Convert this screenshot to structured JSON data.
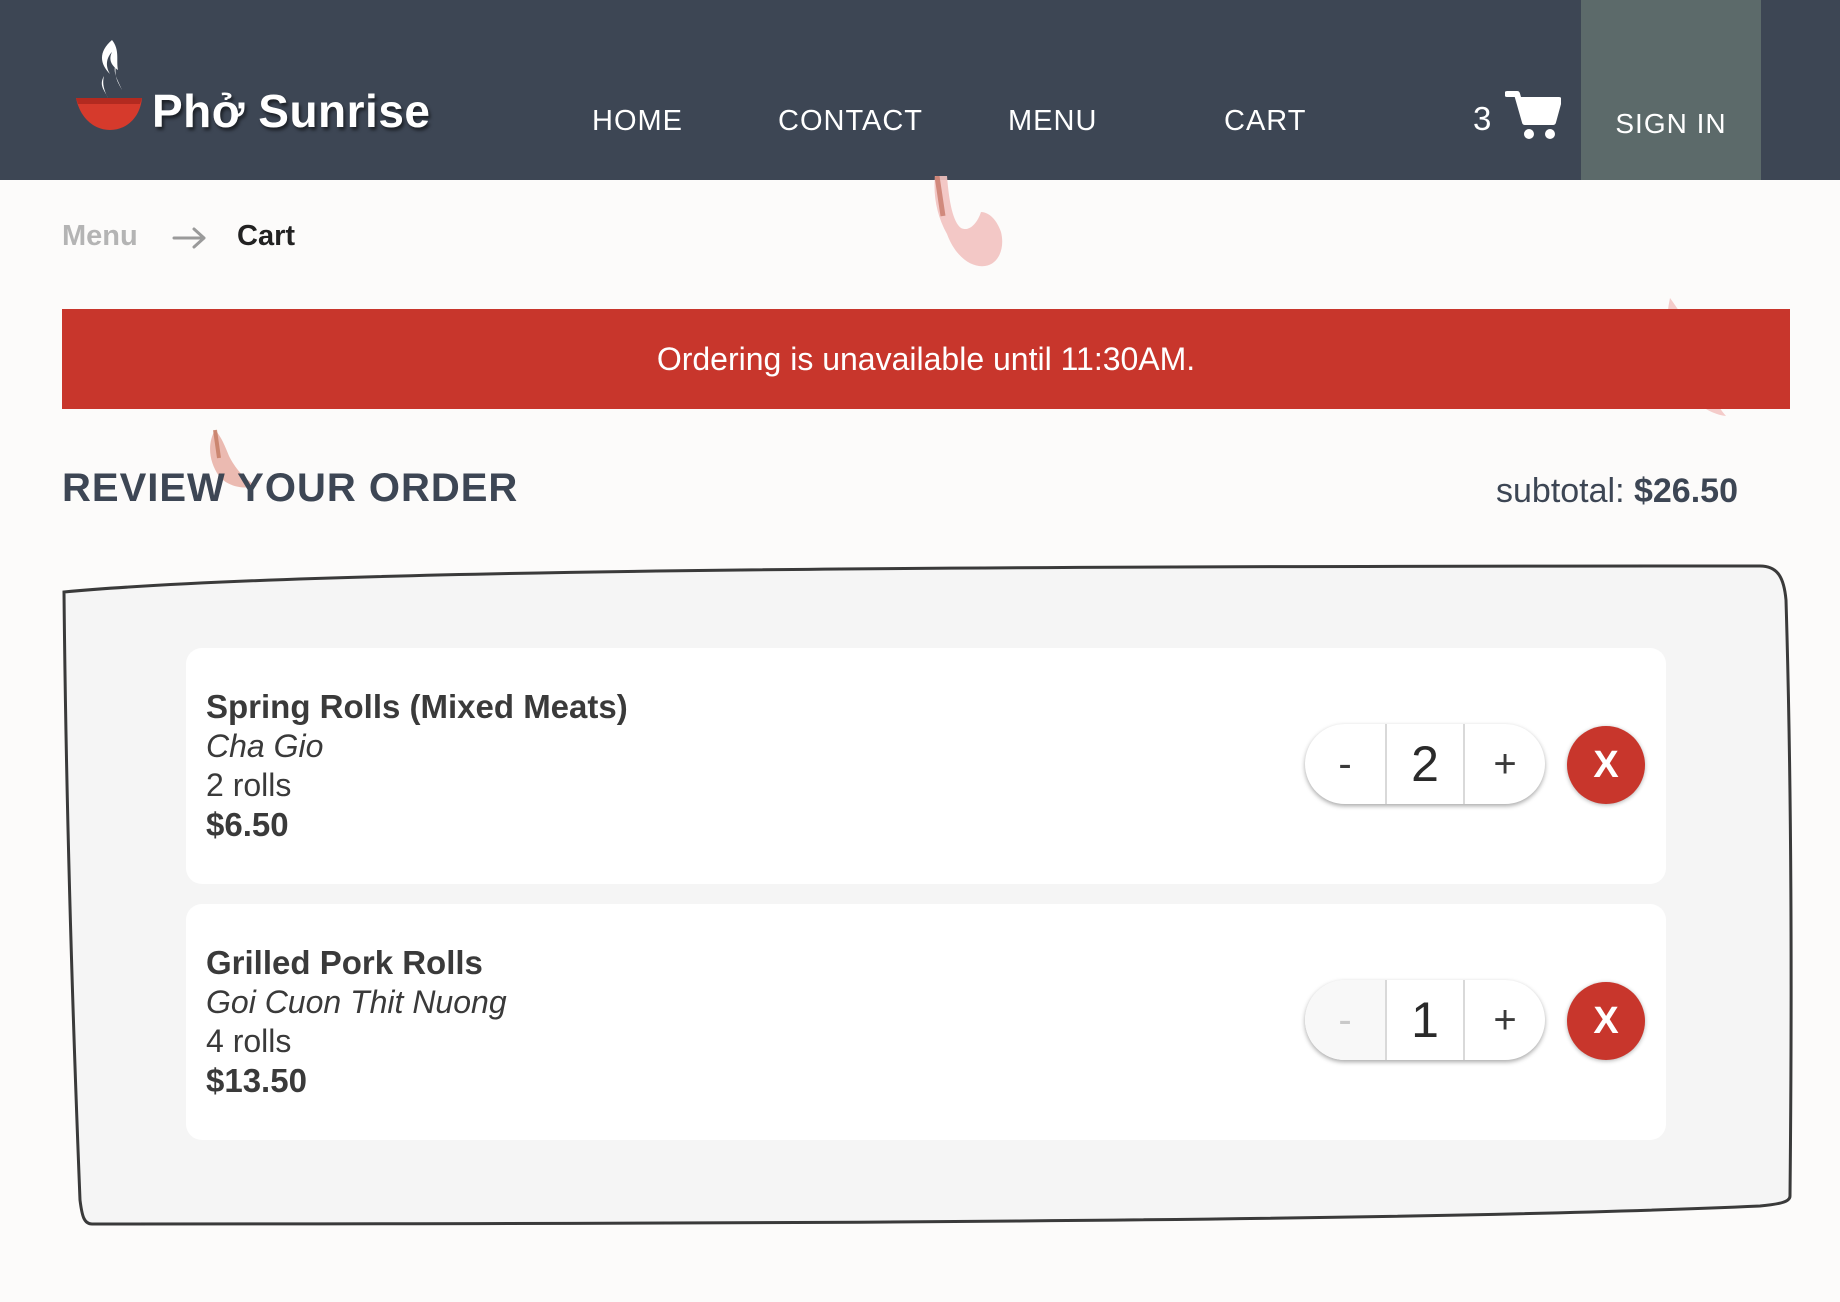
{
  "header": {
    "brand": "Phở Sunrise",
    "nav": [
      {
        "label": "HOME"
      },
      {
        "label": "CONTACT"
      },
      {
        "label": "MENU"
      },
      {
        "label": "CART"
      }
    ],
    "cart_count": "3",
    "sign_in_label": "SIGN IN"
  },
  "breadcrumb": {
    "items": [
      {
        "label": "Menu"
      },
      {
        "label": "Cart"
      }
    ]
  },
  "banner": {
    "message": "Ordering is unavailable until 11:30AM."
  },
  "review": {
    "title": "REVIEW YOUR ORDER",
    "subtotal_label": "subtotal:",
    "subtotal_value": "$26.50"
  },
  "order_items": [
    {
      "name": "Spring Rolls (Mixed Meats)",
      "vietnamese_name": "Cha Gio",
      "portion": "2 rolls",
      "price": "$6.50",
      "quantity": "2",
      "minus_label": "-",
      "plus_label": "+",
      "remove_label": "X"
    },
    {
      "name": "Grilled Pork Rolls",
      "vietnamese_name": "Goi Cuon Thit Nuong",
      "portion": "4 rolls",
      "price": "$13.50",
      "quantity": "1",
      "minus_label": "-",
      "plus_label": "+",
      "remove_label": "X"
    }
  ],
  "colors": {
    "header_bg": "#3d4654",
    "sign_in_bg": "#5c6a6a",
    "accent_red": "#c8362c",
    "page_bg": "#fcfbfa",
    "panel_bg": "#f5f5f5"
  },
  "icons": [
    "steam-bowl-logo-icon",
    "cart-icon",
    "arrow-right-icon"
  ]
}
